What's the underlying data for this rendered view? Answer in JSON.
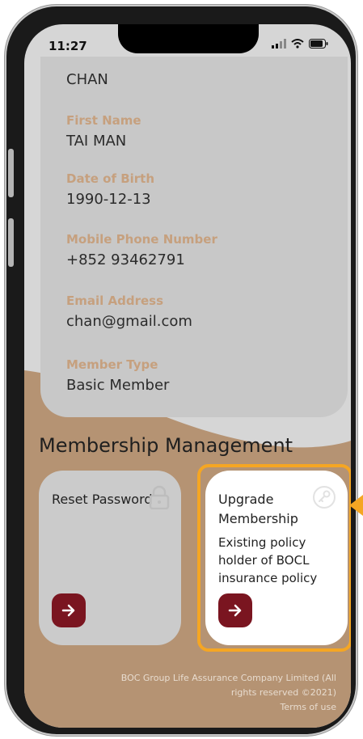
{
  "status_bar": {
    "time": "11:27"
  },
  "profile": {
    "last_name_value": "CHAN",
    "fields": [
      {
        "label": "First Name",
        "value": "TAI MAN"
      },
      {
        "label": "Date of Birth",
        "value": "1990-12-13"
      },
      {
        "label": "Mobile Phone Number",
        "value": "+852 93462791"
      },
      {
        "label": "Email Address",
        "value": "chan@gmail.com"
      },
      {
        "label": "Member Type",
        "value": "Basic Member"
      }
    ]
  },
  "membership": {
    "title": "Membership Management",
    "reset": {
      "title": "Reset Password",
      "icon": "lock-icon"
    },
    "upgrade": {
      "title": "Upgrade Membership",
      "description": "Existing policy holder of BOCL insurance policy",
      "icon": "key-icon"
    }
  },
  "footer": {
    "copyright": "BOC Group Life Assurance Company Limited (All rights reserved ©2021)",
    "terms": "Terms of use"
  },
  "colors": {
    "accent_label": "#c6a07e",
    "button": "#7a1520",
    "highlight": "#f5a623",
    "wave": "#b59373"
  }
}
